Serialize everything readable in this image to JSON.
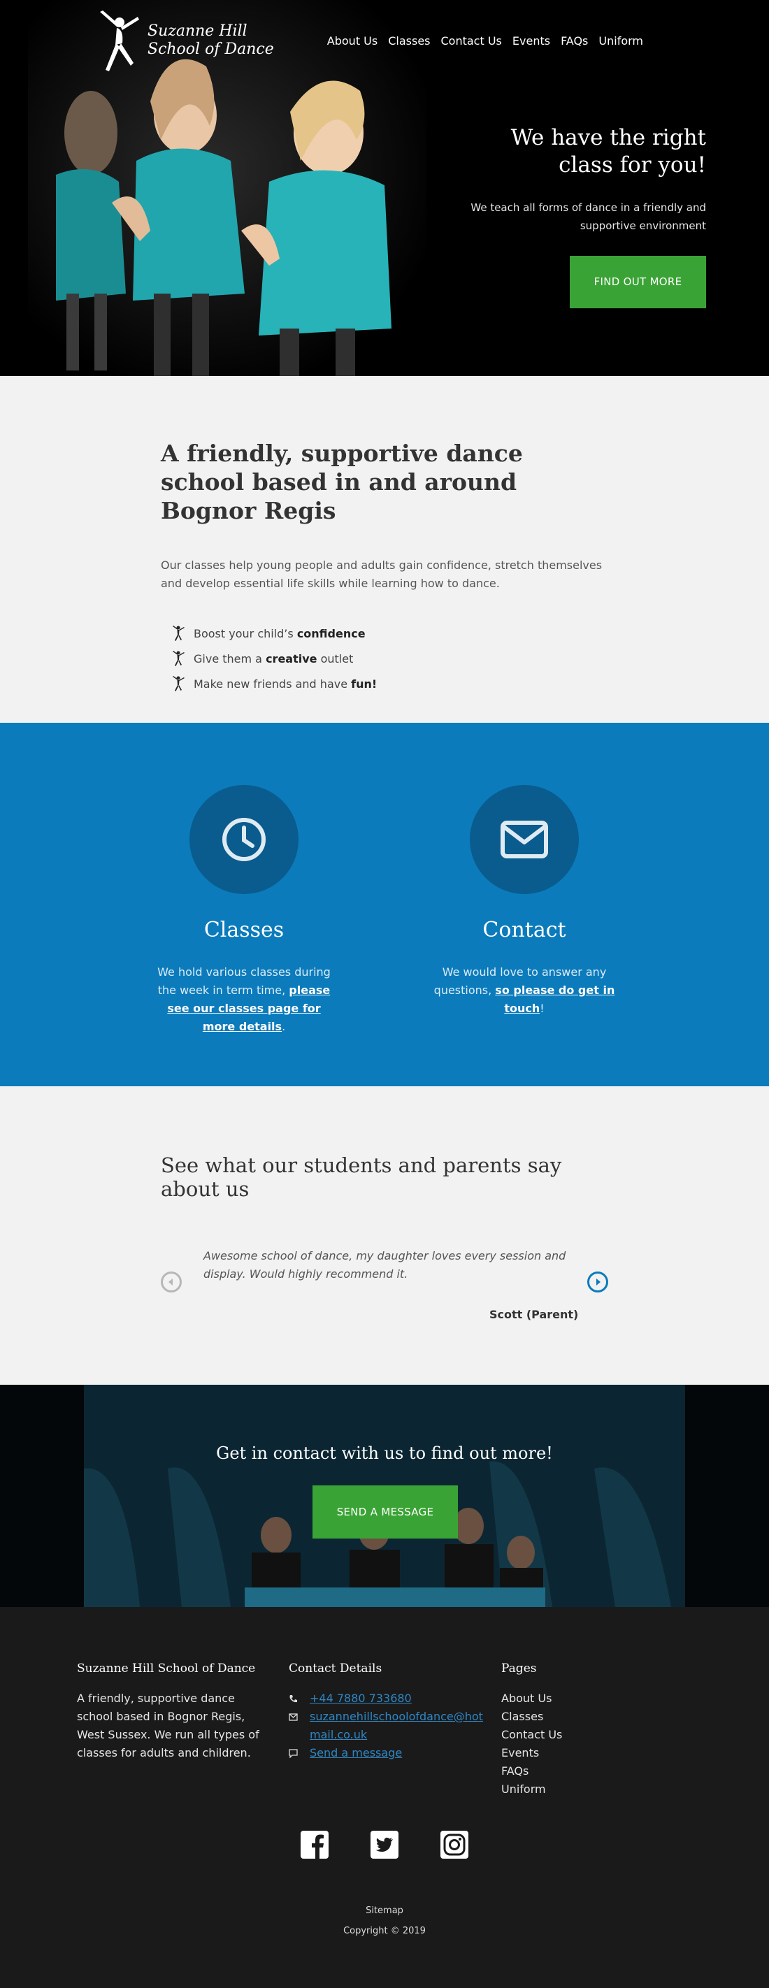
{
  "brand": {
    "logo_line1": "Suzanne Hill",
    "logo_line2": "School of Dance"
  },
  "nav": {
    "items": [
      "About Us",
      "Classes",
      "Contact Us",
      "Events",
      "FAQs",
      "Uniform"
    ]
  },
  "hero": {
    "title": "We have the right class for you!",
    "subtitle": "We teach all forms of dance in a friendly and supportive environment",
    "button_label": "FIND OUT MORE"
  },
  "intro": {
    "heading": "A friendly, supportive dance school based in and around Bognor Regis",
    "paragraph": "Our classes help young people and adults gain confidence, stretch themselves and develop essential life skills while learning how to dance.",
    "benefits": [
      {
        "text": "Boost your child’s ",
        "bold": "confidence",
        "after": ""
      },
      {
        "text": "Give them a ",
        "bold": "creative",
        "after": " outlet"
      },
      {
        "text": "Make new friends and have ",
        "bold": "fun!",
        "after": ""
      }
    ]
  },
  "features": {
    "classes": {
      "icon": "clock-icon",
      "title": "Classes",
      "text": "We hold various classes during the week in term time, ",
      "link": "please see our classes page for more details",
      "after": "."
    },
    "contact": {
      "icon": "envelope-icon",
      "title": "Contact",
      "text": "We would love to answer any questions, ",
      "link": "so please do get in touch",
      "after": "!"
    }
  },
  "testimonials": {
    "heading": "See what our students and parents say about us",
    "quote": "Awesome school of dance, my daughter loves every session and display. Would highly recommend it.",
    "author": "Scott (Parent)"
  },
  "cta": {
    "heading": "Get in contact with us to find out more!",
    "button_label": "SEND A MESSAGE"
  },
  "footer": {
    "about": {
      "heading": "Suzanne Hill School of Dance",
      "text": "A friendly, supportive dance school based in Bognor Regis, West Sussex. We run all types of classes for adults and children."
    },
    "contact": {
      "heading": "Contact Details",
      "phone": "+44 7880 733680",
      "email": "suzannehillschoolofdance@hotmail.co.uk",
      "message": "Send a message"
    },
    "pages": {
      "heading": "Pages",
      "items": [
        "About Us",
        "Classes",
        "Contact Us",
        "Events",
        "FAQs",
        "Uniform"
      ]
    },
    "social": [
      "facebook-icon",
      "twitter-icon",
      "instagram-icon"
    ],
    "sitemap": "Sitemap",
    "copyright": "Copyright © 2019"
  },
  "colors": {
    "accent_green": "#3aa335",
    "brand_blue": "#0b7bbc",
    "footer_bg": "#1a1a1a"
  }
}
